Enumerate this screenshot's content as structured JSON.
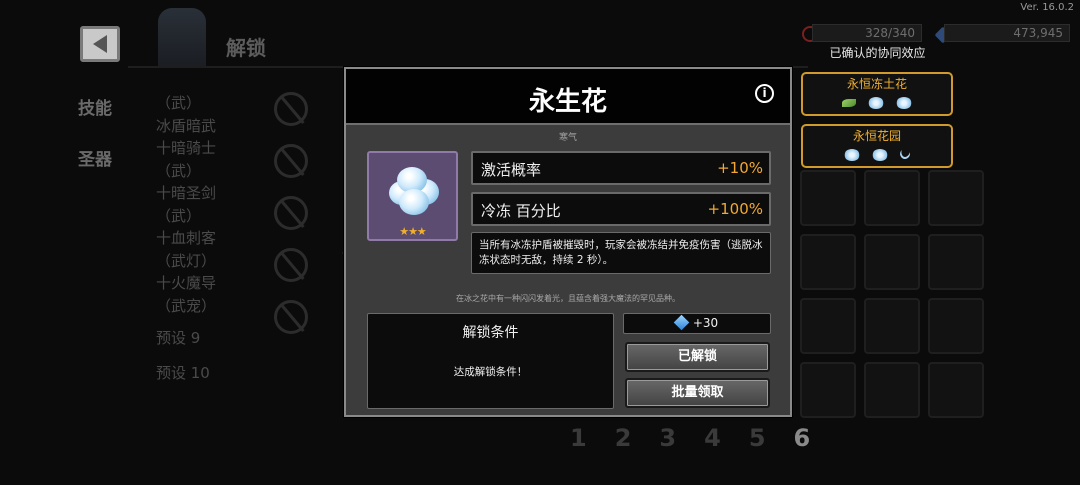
{
  "version": "Ver. 16.0.2",
  "header": {
    "title": "解锁",
    "resource_1": "328/340",
    "resource_2": "473,945"
  },
  "side_nav": [
    "技能",
    "圣器"
  ],
  "list_items": [
    "（武）",
    "冰盾暗武",
    "十暗骑士",
    "（武）",
    "十暗圣剑",
    "（武）",
    "十血刺客",
    "（武灯）",
    "十火魔导",
    "（武宠）"
  ],
  "presets": [
    "预设 9",
    "预设 10"
  ],
  "page_numbers": [
    "1",
    "2",
    "3",
    "4",
    "5",
    "6"
  ],
  "synergy": {
    "title": "已确认的协同效应",
    "items": [
      {
        "name": "永恒冻土花"
      },
      {
        "name": "永恒花园"
      }
    ]
  },
  "modal": {
    "title": "永生花",
    "category": "寒气",
    "stars": "★★★",
    "stats": [
      {
        "label": "激活概率",
        "value": "+10%"
      },
      {
        "label": "冷冻 百分比",
        "value": "+100%"
      }
    ],
    "description": "当所有冰冻护盾被摧毁时，玩家会被冻结并免疫伤害（逃脱冰冻状态时无敌，持续 2 秒）。",
    "flavor": "在冰之花中有一种闪闪发着光，且蕴含着强大魔法的罕见品种。",
    "unlock_condition_title": "解锁条件",
    "unlock_condition_text": "达成解锁条件！",
    "reward": "+30",
    "unlocked_button": "已解锁",
    "batch_claim_button": "批量领取"
  },
  "colors": {
    "accent_gold": "#f2a832",
    "frame_gold": "#d09a2c",
    "item_frame_purple": "#5d4c72"
  }
}
